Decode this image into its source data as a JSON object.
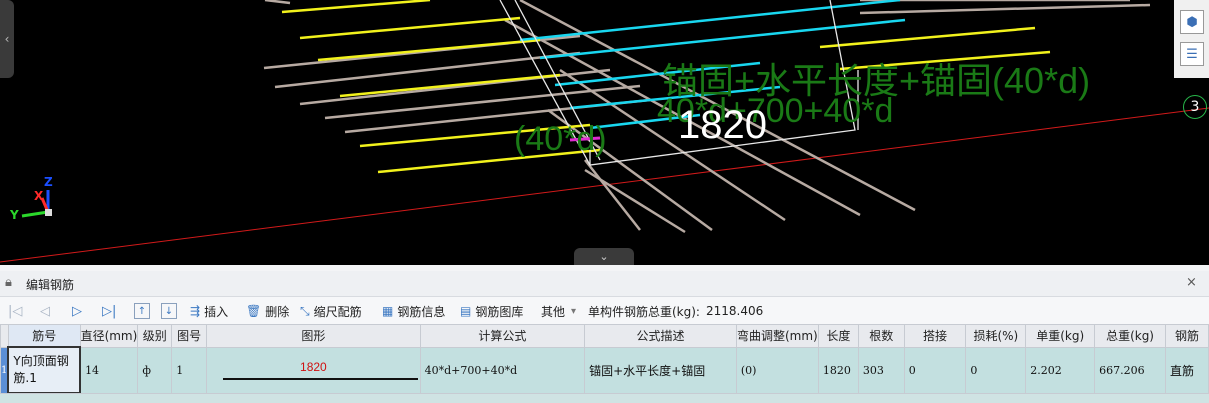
{
  "viewport": {
    "formula_label": "锚固+水平长度+锚固(40*d)",
    "expr_label": "40*d+700+40*d",
    "anchor_label": "(40*d)",
    "length_label": "1820",
    "view_number": "3",
    "axis": {
      "x": "X",
      "y": "Y",
      "z": "Z"
    },
    "colors": {
      "background": "#000000",
      "bar_cyan": "#19d7f0",
      "bar_yellow": "#f2f21c",
      "bar_grey": "#b7aaa2",
      "label_green": "#1a7a16",
      "axis_line": "#d21a1a"
    },
    "icons": {
      "left_tab": "chevron-left-icon",
      "bottom_tab": "chevron-down-icon",
      "cube": "cube-icon",
      "list": "list-icon"
    }
  },
  "panel": {
    "title": "编辑钢筋",
    "close": "×",
    "lock_icon": "lock-icon"
  },
  "toolbar": {
    "first": "|◁",
    "prev": "◁",
    "next": "▷",
    "last": "▷|",
    "move_up": "↑",
    "move_down": "↓",
    "insert": "插入",
    "delete": "删除",
    "scale_rebar": "缩尺配筋",
    "rebar_info": "钢筋信息",
    "rebar_library": "钢筋图库",
    "other": "其他",
    "dropdown": "▾",
    "total_weight_label": "单构件钢筋总重(kg):",
    "total_weight_value": "2118.406"
  },
  "table": {
    "columns": [
      "筋号",
      "直径(mm)",
      "级别",
      "图号",
      "图形",
      "计算公式",
      "公式描述",
      "弯曲调整(mm)",
      "长度",
      "根数",
      "搭接",
      "损耗(%)",
      "单重(kg)",
      "总重(kg)",
      "钢筋"
    ],
    "row": {
      "index": "1",
      "name": "Y向顶面钢筋.1",
      "diameter": "14",
      "grade": "ф",
      "figure_no": "1",
      "shape_length": "1820",
      "formula": "40*d+700+40*d",
      "description": "锚固+水平长度+锚固",
      "bend_adjust": "(0)",
      "length": "1820",
      "count": "303",
      "lap": "0",
      "loss": "0",
      "unit_weight": "2.202",
      "total_weight": "667.206",
      "type": "直筋"
    }
  }
}
